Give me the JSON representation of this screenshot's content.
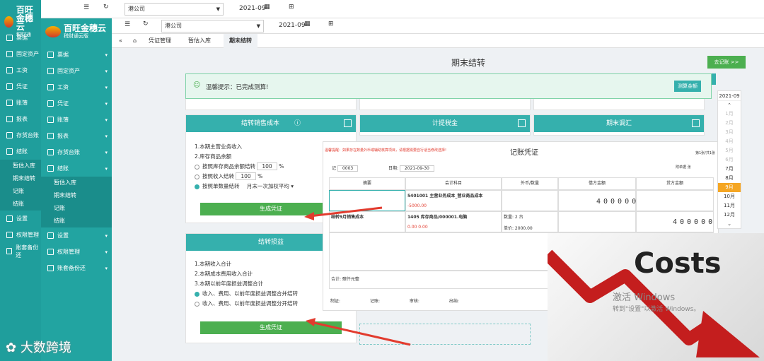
{
  "brand": {
    "name": "百旺金穗云",
    "sub_back": "税财通",
    "sub_front": "税财通云版"
  },
  "company": {
    "name": "港公司",
    "name_front": "港公司"
  },
  "period": "2021-09",
  "tabs": [
    "凭证管理",
    "暂估入库",
    "期末结转"
  ],
  "back_nav": [
    "票据",
    "固定资产",
    "工资",
    "凭证",
    "账簿",
    "报表",
    "存货台账",
    "结账",
    "暂估入库",
    "期末结转",
    "记账",
    "结账",
    "设置",
    "权限管理",
    "账套备份还"
  ],
  "front_nav": [
    "票据",
    "固定资产",
    "工资",
    "凭证",
    "账簿",
    "报表",
    "存货台账",
    "结账",
    "暂估入库",
    "期末结转",
    "记账",
    "结账",
    "设置",
    "权限管理",
    "账套备份还"
  ],
  "page_title": "期末结转",
  "go_ledger": "去记账 >>",
  "notice": {
    "text": "温馨提示：已完成测算!",
    "calc_btn": "测算金额"
  },
  "cards": {
    "sales_cost": {
      "title": "结转销售成本",
      "lines": [
        "1.本期主营业务收入",
        "2.库存商品余额"
      ],
      "opt1": "按照库存商品余额结转",
      "opt1_val": "100",
      "opt2": "按照收入结转",
      "opt2_val": "100",
      "opt3": "按照单数量结转",
      "method": "月末一次加权平均",
      "pct": "%",
      "gen_btn": "生成凭证"
    },
    "tax": {
      "title": "计提税金"
    },
    "adjust": {
      "title": "期末调汇"
    },
    "pl": {
      "title": "结转损益",
      "lines": [
        "1.本期收入合计",
        "2.本期成本费用收入合计",
        "3.本期以前年度损益调整合计"
      ],
      "opt1": "收入、费用、以前年度损益调整合并结转",
      "opt2": "收入、费用、以前年度损益调整分开结转",
      "gen_btn": "生成凭证"
    }
  },
  "voucher": {
    "warning": "温馨提醒：如果存在数量外币或辅助核算项目，请根据需要自行适当修改选择!",
    "title": "记账凭证",
    "page": "第1张/共1张",
    "word": "记",
    "no": "0003",
    "date_label": "日期:",
    "date": "2021-09-30",
    "attach": "附单据",
    "attach_unit": "张",
    "col_summary": "摘要",
    "col_account": "会计科目",
    "col_qty": "外币/数量",
    "col_debit": "借方金额",
    "col_credit": "贷方金额",
    "row1_account": "5401001 主营业务成本_营业商品成本",
    "row1_amt": "-5000.00",
    "row2_summary": "结转9月销售成本",
    "row2_account": "1405 库存商品/000001.电脑",
    "row2_qty": "数量: 2 台",
    "row2_price": "单价: 2000.00",
    "row2_amt1": "0.00",
    "row2_amt2": "0.00",
    "debit_digits": "400000",
    "credit_digits": "400000",
    "total": "合计: 肆仟元整",
    "footer": [
      "制证:",
      "记账:",
      "审核:",
      "出纳:"
    ]
  },
  "calendar": {
    "current": "2021-09",
    "months": [
      "1月",
      "2月",
      "3月",
      "4月",
      "5月",
      "6月",
      "7月",
      "8月",
      "9月",
      "10月",
      "11月",
      "12月"
    ],
    "year_badge": "2021"
  },
  "overlay": {
    "costs": "Costs",
    "win1": "激活 Windows",
    "win2": "转到\"设置\"以激活 Windows。"
  },
  "watermark": "大数跨境",
  "colors": {
    "teal": "#1f9e9c",
    "header": "#35b0ad",
    "green": "#4caf50",
    "red": "#e23b2e"
  }
}
